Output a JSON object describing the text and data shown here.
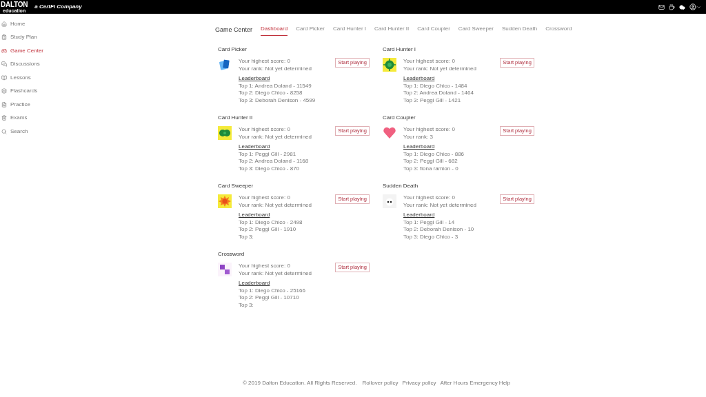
{
  "header": {
    "logo": "DALTON",
    "logo_sub": "education",
    "tagline": "a CertFi Company"
  },
  "sidebar": {
    "items": [
      {
        "label": "Home",
        "kind": "home",
        "selected": false
      },
      {
        "label": "Study Plan",
        "kind": "plan",
        "selected": false
      },
      {
        "label": "Game Center",
        "kind": "game",
        "selected": true
      },
      {
        "label": "Discussions",
        "kind": "chat",
        "selected": false
      },
      {
        "label": "Lessons",
        "kind": "book",
        "selected": false
      },
      {
        "label": "Flashcards",
        "kind": "cards",
        "selected": false
      },
      {
        "label": "Practice",
        "kind": "list",
        "selected": false
      },
      {
        "label": "Exams",
        "kind": "trash",
        "selected": false
      },
      {
        "label": "Search",
        "kind": "search",
        "selected": false
      }
    ]
  },
  "page_title": "Game Center",
  "tabs": [
    {
      "label": "Dashboard",
      "selected": true
    },
    {
      "label": "Card Picker",
      "selected": false
    },
    {
      "label": "Card Hunter I",
      "selected": false
    },
    {
      "label": "Card Hunter II",
      "selected": false
    },
    {
      "label": "Card Coupler",
      "selected": false
    },
    {
      "label": "Card Sweeper",
      "selected": false
    },
    {
      "label": "Sudden Death",
      "selected": false
    },
    {
      "label": "Crossword",
      "selected": false
    }
  ],
  "games": [
    {
      "title": "Card Picker",
      "kind": "cards",
      "score": "Your highest score: 0",
      "rank": "Your rank: Not yet determined",
      "leaderboard_title": "Leaderboard",
      "leaders": [
        "Top 1: Andrea Doland - 11549",
        "Top 2: Diego Chico - 8258",
        "Top 3: Deborah Denison - 4599"
      ],
      "button": "Start playing"
    },
    {
      "title": "Card Hunter I",
      "kind": "target",
      "score": "Your highest score: 0",
      "rank": "Your rank: Not yet determined",
      "leaderboard_title": "Leaderboard",
      "leaders": [
        "Top 1: Diego Chico - 1484",
        "Top 2: Andrea Doland - 1464",
        "Top 3: Peggi Gill - 1421"
      ],
      "button": "Start playing"
    },
    {
      "title": "Card Hunter II",
      "kind": "double",
      "score": "Your highest score: 0",
      "rank": "Your rank: Not yet determined",
      "leaderboard_title": "Leaderboard",
      "leaders": [
        "Top 1: Peggi Gill - 2981",
        "Top 2: Andrea Doland - 1168",
        "Top 3: Diego Chico - 870"
      ],
      "button": "Start playing"
    },
    {
      "title": "Card Coupler",
      "kind": "heart",
      "score": "Your highest score: 0",
      "rank": "Your rank: 3",
      "leaderboard_title": "Leaderboard",
      "leaders": [
        "Top 1: Diego Chico - 886",
        "Top 2: Peggi Gill - 682",
        "Top 3: fiona ramion - 0"
      ],
      "button": "Start playing"
    },
    {
      "title": "Card Sweeper",
      "kind": "sun",
      "score": "Your highest score: 0",
      "rank": "Your rank: Not yet determined",
      "leaderboard_title": "Leaderboard",
      "leaders": [
        "Top 1: Diego Chico - 2498",
        "Top 2: Peggi Gill - 1910",
        "Top 3:"
      ],
      "button": "Start playing"
    },
    {
      "title": "Sudden Death",
      "kind": "ghost",
      "score": "Your highest score: 0",
      "rank": "Your rank: Not yet determined",
      "leaderboard_title": "Leaderboard",
      "leaders": [
        "Top 1: Peggi Gill - 14",
        "Top 2: Deborah Denison - 10",
        "Top 3: Diego Chico - 3"
      ],
      "button": "Start playing"
    },
    {
      "title": "Crossword",
      "kind": "squares",
      "score": "Your highest score: 0",
      "rank": "Your rank: Not yet determined",
      "leaderboard_title": "Leaderboard",
      "leaders": [
        "Top 1: Diego Chico - 25166",
        "Top 2: Peggi Gill - 10710",
        "Top 3:"
      ],
      "button": "Start playing"
    }
  ],
  "footer": {
    "copyright": "© 2019 Dalton Education. All Rights Reserved.",
    "links": [
      "Rollover policy",
      "Privacy policy",
      "After Hours Emergency Help"
    ]
  }
}
